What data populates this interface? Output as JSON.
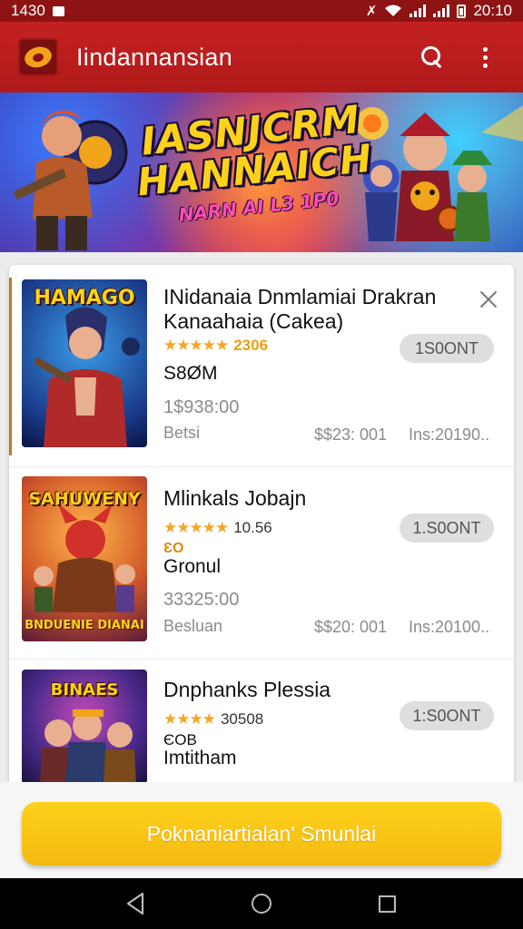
{
  "status_bar": {
    "time": "1430",
    "clock": "20:10",
    "icons": [
      "notification-icon",
      "alarm-icon",
      "wifi-icon",
      "signal-icon",
      "signal-icon",
      "battery-icon"
    ]
  },
  "app_bar": {
    "title": "Iindannansian",
    "actions": [
      "search-icon",
      "more-vert-icon"
    ]
  },
  "banner": {
    "title_line1": "IASNJCRM",
    "title_line2": "HANNAICH",
    "subtitle": "NARN AI L3 1P0"
  },
  "items": [
    {
      "thumb_title": "HAMAGO",
      "thumb_bottom": "",
      "title": "INidanaia Dnmlamiai Drakran Kanaahaia (Cakea)",
      "rating": "2306",
      "rating_style": "gold",
      "button": "1S0ONT",
      "line1": "S8ØM",
      "line1_style": "dark",
      "line2": "",
      "price_original": "1$938:00",
      "category": "Betsi",
      "price": "$$23: 001",
      "installs": "Ins:20190..",
      "closable": true
    },
    {
      "thumb_title": "SAHUWENY",
      "thumb_bottom": "BNDUENIE DIANAI",
      "title": "Mlinkals Jobajn",
      "rating": "10.56",
      "rating_style": "plain",
      "button": "1.S0ONT",
      "line1": "ƐO",
      "line1_style": "orange",
      "line2": "Gronul",
      "price_original": "33325:00",
      "category": "Besluan",
      "price": "$$20: 001",
      "installs": "Ins:20100..",
      "closable": false
    },
    {
      "thumb_title": "BINAES",
      "thumb_bottom": "",
      "title": "Dnphanks Plessia",
      "rating": "30508",
      "rating_style": "plain",
      "button": "1:S0ONT",
      "line1": "ЄOB",
      "line1_style": "dark",
      "line2": "Imtitham",
      "price_original": "",
      "category": "",
      "price": "",
      "installs": "",
      "closable": false
    }
  ],
  "cta": {
    "label": "Poknaniartialan' Smunlai"
  },
  "nav": [
    "back-icon",
    "home-icon",
    "recents-icon"
  ],
  "colors": {
    "brand": "#c42121",
    "accent": "#f4ba10",
    "star": "#f5a623"
  }
}
